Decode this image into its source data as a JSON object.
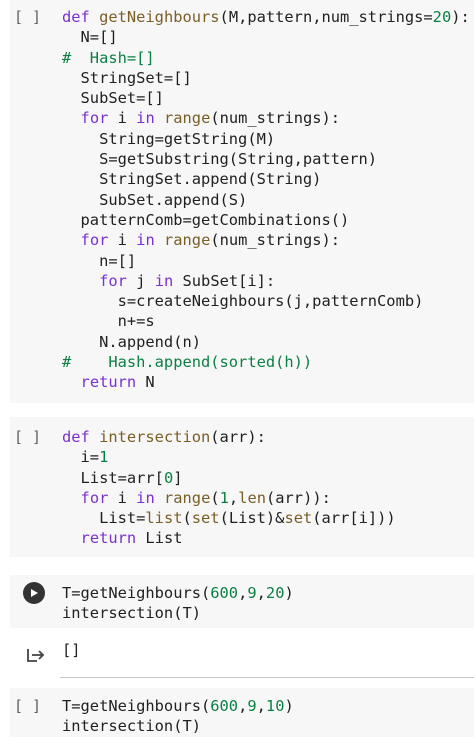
{
  "cells": [
    {
      "gutter": "[ ]",
      "lines": [
        [
          {
            "t": "def ",
            "c": "kw"
          },
          {
            "t": "getNeighbours",
            "c": "fn"
          },
          {
            "t": "(M,pattern,num_strings=",
            "c": "pl"
          },
          {
            "t": "20",
            "c": "num"
          },
          {
            "t": "):",
            "c": "pl"
          }
        ],
        [
          {
            "t": "  N=[]",
            "c": "pl"
          }
        ],
        [
          {
            "t": "#  Hash=[]",
            "c": "cm"
          }
        ],
        [
          {
            "t": "  StringSet=[]",
            "c": "pl"
          }
        ],
        [
          {
            "t": "  SubSet=[]",
            "c": "pl"
          }
        ],
        [
          {
            "t": "  ",
            "c": "pl"
          },
          {
            "t": "for",
            "c": "kw"
          },
          {
            "t": " i ",
            "c": "pl"
          },
          {
            "t": "in",
            "c": "kw"
          },
          {
            "t": " ",
            "c": "pl"
          },
          {
            "t": "range",
            "c": "bi"
          },
          {
            "t": "(num_strings):",
            "c": "pl"
          }
        ],
        [
          {
            "t": "    String=getString(M)",
            "c": "pl"
          }
        ],
        [
          {
            "t": "    S=getSubstring(String,pattern)",
            "c": "pl"
          }
        ],
        [
          {
            "t": "    StringSet.append(String)",
            "c": "pl"
          }
        ],
        [
          {
            "t": "    SubSet.append(S)",
            "c": "pl"
          }
        ],
        [
          {
            "t": "  patternComb=getCombinations()",
            "c": "pl"
          }
        ],
        [
          {
            "t": "  ",
            "c": "pl"
          },
          {
            "t": "for",
            "c": "kw"
          },
          {
            "t": " i ",
            "c": "pl"
          },
          {
            "t": "in",
            "c": "kw"
          },
          {
            "t": " ",
            "c": "pl"
          },
          {
            "t": "range",
            "c": "bi"
          },
          {
            "t": "(num_strings):",
            "c": "pl"
          }
        ],
        [
          {
            "t": "    n=[]",
            "c": "pl"
          }
        ],
        [
          {
            "t": "    ",
            "c": "pl"
          },
          {
            "t": "for",
            "c": "kw"
          },
          {
            "t": " j ",
            "c": "pl"
          },
          {
            "t": "in",
            "c": "kw"
          },
          {
            "t": " SubSet[i]:",
            "c": "pl"
          }
        ],
        [
          {
            "t": "      s=createNeighbours(j,patternComb)",
            "c": "pl"
          }
        ],
        [
          {
            "t": "      n+=s",
            "c": "pl"
          }
        ],
        [
          {
            "t": "    N.append(n)",
            "c": "pl"
          }
        ],
        [
          {
            "t": "#    Hash.append(sorted(h))",
            "c": "cm"
          }
        ],
        [
          {
            "t": "  ",
            "c": "pl"
          },
          {
            "t": "return",
            "c": "kw"
          },
          {
            "t": " N",
            "c": "pl"
          }
        ]
      ]
    },
    {
      "gutter": "[ ]",
      "lines": [
        [
          {
            "t": "def ",
            "c": "kw"
          },
          {
            "t": "intersection",
            "c": "fn"
          },
          {
            "t": "(arr):",
            "c": "pl"
          }
        ],
        [
          {
            "t": "  i=",
            "c": "pl"
          },
          {
            "t": "1",
            "c": "num"
          }
        ],
        [
          {
            "t": "  List=arr[",
            "c": "pl"
          },
          {
            "t": "0",
            "c": "num"
          },
          {
            "t": "]",
            "c": "pl"
          }
        ],
        [
          {
            "t": "  ",
            "c": "pl"
          },
          {
            "t": "for",
            "c": "kw"
          },
          {
            "t": " i ",
            "c": "pl"
          },
          {
            "t": "in",
            "c": "kw"
          },
          {
            "t": " ",
            "c": "pl"
          },
          {
            "t": "range",
            "c": "bi"
          },
          {
            "t": "(",
            "c": "pl"
          },
          {
            "t": "1",
            "c": "num"
          },
          {
            "t": ",",
            "c": "pl"
          },
          {
            "t": "len",
            "c": "bi"
          },
          {
            "t": "(arr)):",
            "c": "pl"
          }
        ],
        [
          {
            "t": "    List=",
            "c": "pl"
          },
          {
            "t": "list",
            "c": "bi"
          },
          {
            "t": "(",
            "c": "pl"
          },
          {
            "t": "set",
            "c": "bi"
          },
          {
            "t": "(List)&",
            "c": "pl"
          },
          {
            "t": "set",
            "c": "bi"
          },
          {
            "t": "(arr[i]))",
            "c": "pl"
          }
        ],
        [
          {
            "t": "  ",
            "c": "pl"
          },
          {
            "t": "return",
            "c": "kw"
          },
          {
            "t": " List",
            "c": "pl"
          }
        ]
      ]
    },
    {
      "gutter": "",
      "lines": [
        [
          {
            "t": "T=getNeighbours(",
            "c": "pl"
          },
          {
            "t": "600",
            "c": "num"
          },
          {
            "t": ",",
            "c": "pl"
          },
          {
            "t": "9",
            "c": "num"
          },
          {
            "t": ",",
            "c": "pl"
          },
          {
            "t": "20",
            "c": "num"
          },
          {
            "t": ")",
            "c": "pl"
          }
        ],
        [
          {
            "t": "intersection(T)",
            "c": "pl"
          }
        ]
      ],
      "output": "[]"
    },
    {
      "gutter": "[ ]",
      "lines": [
        [
          {
            "t": "T=getNeighbours(",
            "c": "pl"
          },
          {
            "t": "600",
            "c": "num"
          },
          {
            "t": ",",
            "c": "pl"
          },
          {
            "t": "9",
            "c": "num"
          },
          {
            "t": ",",
            "c": "pl"
          },
          {
            "t": "10",
            "c": "num"
          },
          {
            "t": ")",
            "c": "pl"
          }
        ],
        [
          {
            "t": "intersection(T)",
            "c": "pl"
          }
        ]
      ]
    }
  ],
  "icons": {
    "run": "play-icon",
    "output": "output-arrow-icon"
  }
}
